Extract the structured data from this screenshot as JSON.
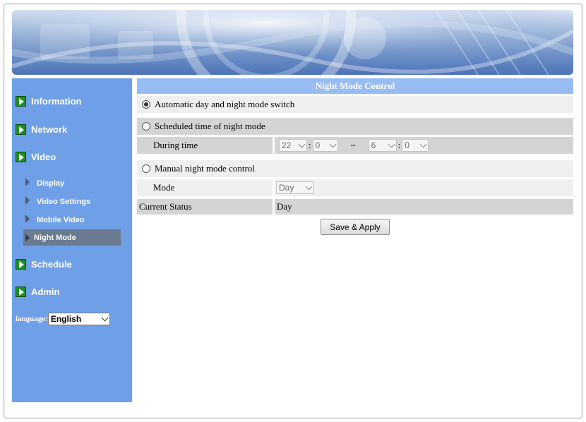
{
  "sidebar": {
    "main_items": [
      {
        "label": "Information"
      },
      {
        "label": "Network"
      },
      {
        "label": "Video"
      },
      {
        "label": "Schedule"
      },
      {
        "label": "Admin"
      }
    ],
    "video_sub_items": [
      {
        "label": "Display"
      },
      {
        "label": "Video Settings"
      },
      {
        "label": "Mobile Video"
      },
      {
        "label": "Night Mode",
        "active": true
      }
    ],
    "language_label": "language:",
    "language_value": "English"
  },
  "panel": {
    "title": "Night Mode Control",
    "auto_option": "Automatic day and night mode switch",
    "scheduled_option": "Scheduled time of night mode",
    "during_time_label": "During time",
    "start_hour": "22",
    "start_minute": "0",
    "time_separator": ":",
    "range_separator": "~",
    "end_hour": "6",
    "end_minute": "0",
    "manual_option": "Manual night mode control",
    "mode_label": "Mode",
    "mode_value": "Day",
    "current_status_label": "Current Status",
    "current_status_value": "Day",
    "save_button": "Save & Apply"
  },
  "colors": {
    "sidebar_bg": "#6f9fe7",
    "header_bg": "#98bdf2",
    "active_item_bg": "#6a7b91"
  }
}
